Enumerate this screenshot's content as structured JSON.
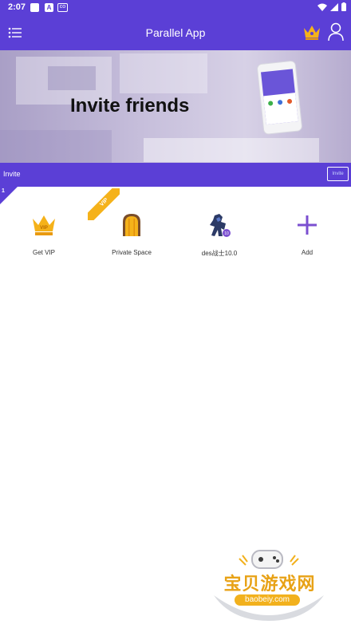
{
  "status_bar": {
    "time": "2:07",
    "notification_letter": "A",
    "cast_label": "co"
  },
  "app_bar": {
    "title": "Parallel App"
  },
  "banner": {
    "headline": "Invite friends"
  },
  "invite_strip": {
    "label": "Invite",
    "button_label": "Invite"
  },
  "apps": {
    "badge_count": "1",
    "vip_ribbon": "VIP",
    "items": [
      {
        "label": "Get VIP",
        "icon": "crown-vip-icon"
      },
      {
        "label": "Private Space",
        "icon": "private-space-icon"
      },
      {
        "label": "des战士10.0",
        "icon": "robot-game-icon"
      },
      {
        "label": "Add",
        "icon": "plus-icon"
      }
    ]
  },
  "watermark": {
    "brand": "宝贝游戏网",
    "url": "baobeiy.com"
  },
  "colors": {
    "primary": "#5b3fd6",
    "gold": "#f5b21a",
    "accent_purple": "#7b4fd0"
  }
}
